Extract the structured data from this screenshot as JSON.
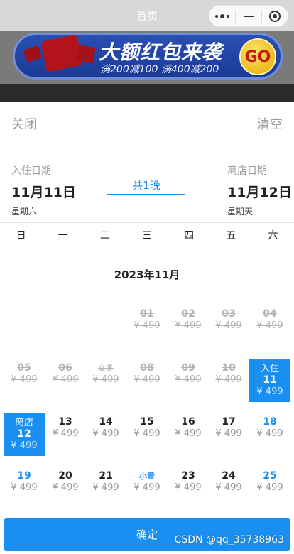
{
  "nav": {
    "title": "首页"
  },
  "banner": {
    "headline": "大额红包来袭",
    "subline": "满200减100 满400减200",
    "go_label": "GO"
  },
  "sheet": {
    "close_label": "关闭",
    "clear_label": "清空"
  },
  "stay": {
    "checkin_label": "入住日期",
    "checkin_date": "11月11日",
    "checkin_weekday": "星期六",
    "nights_label": "共1晚",
    "checkout_label": "离店日期",
    "checkout_date": "11月12日",
    "checkout_weekday": "星期天"
  },
  "weekdays": [
    "日",
    "一",
    "二",
    "三",
    "四",
    "五",
    "六"
  ],
  "month_title": "2023年11月",
  "price": "¥ 499",
  "days": {
    "d01": "01",
    "d02": "02",
    "d03": "03",
    "d04": "04",
    "d05": "05",
    "d06": "06",
    "d07": "立冬",
    "d08": "08",
    "d09": "09",
    "d10": "10",
    "d11_tag": "入住",
    "d11": "11",
    "d12_tag": "离店",
    "d12": "12",
    "d13": "13",
    "d14": "14",
    "d15": "15",
    "d16": "16",
    "d17": "17",
    "d18": "18",
    "d19": "19",
    "d20": "20",
    "d21": "21",
    "d22": "小雪",
    "d23": "23",
    "d24": "24",
    "d25": "25"
  },
  "confirm_label": "确定",
  "watermark": "CSDN @qq_35738963",
  "colors": {
    "accent": "#1a8ff2",
    "muted": "#999999"
  }
}
